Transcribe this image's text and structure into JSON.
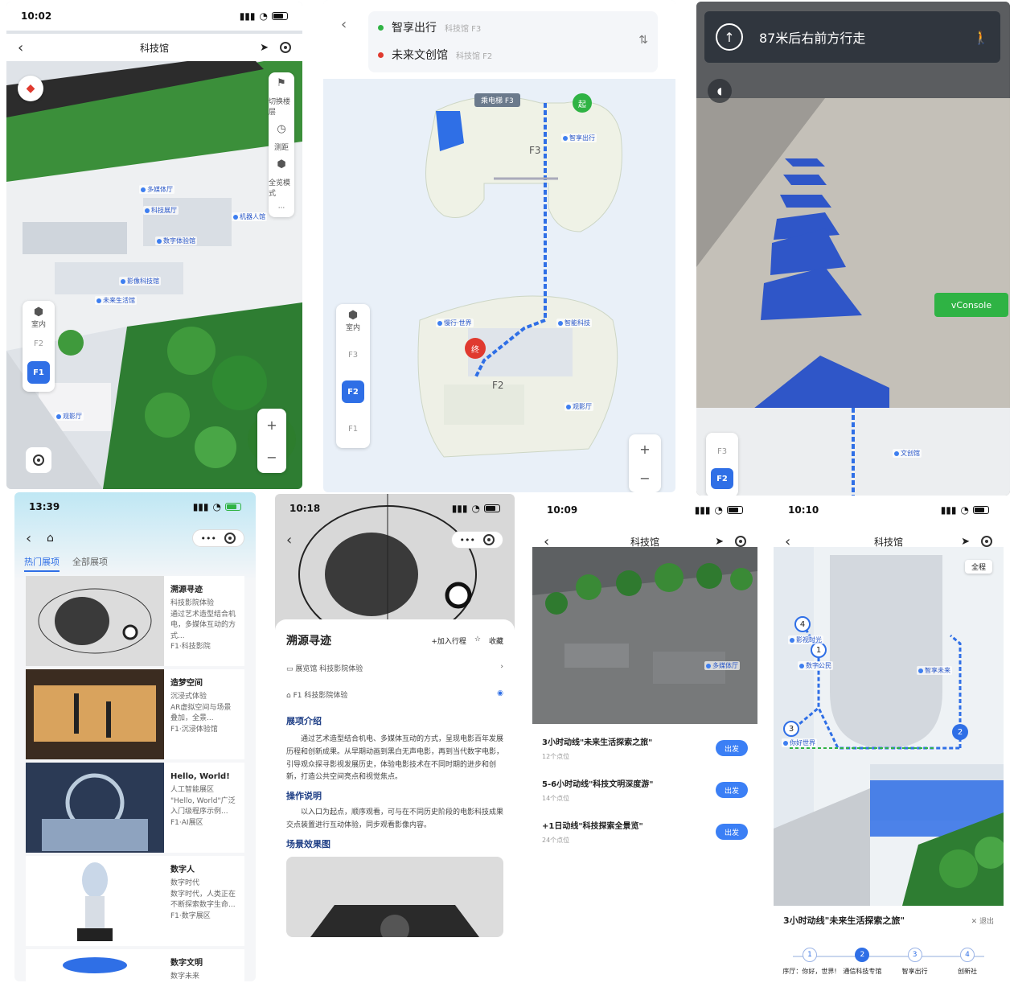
{
  "colors": {
    "accent": "#2f6fe6",
    "green": "#2fb344",
    "red": "#e03a2f",
    "tree": "#3f8f3a"
  },
  "p1": {
    "time": "10:02",
    "title": "科技馆",
    "side_tools": [
      "切换楼层",
      "测距",
      "全览模式"
    ],
    "floors": [
      "F2",
      "F1"
    ],
    "layers_label": "室内",
    "zoom_in": "+",
    "zoom_out": "−",
    "pois": [
      "多媒体厅",
      "科技展厅",
      "机器人馆",
      "数字体验馆",
      "影像科技馆",
      "未来生活馆",
      "观影厅"
    ]
  },
  "p2": {
    "from_label": "智享出行",
    "from_sub": "科技馆 F3",
    "to_label": "未来文创馆",
    "to_sub": "科技馆 F2",
    "elevator": "乘电梯 F3",
    "start": "起",
    "end": "终",
    "floors": [
      "室内",
      "F3",
      "F2",
      "F1"
    ],
    "floor_tags": [
      "F3",
      "F2"
    ],
    "pois": [
      "智享出行",
      "慢行·世界",
      "智能科技",
      "观影厅"
    ]
  },
  "p3": {
    "instruction": "87米后右前方行走",
    "vconsole": "vConsole",
    "floors": [
      "F3",
      "F2"
    ],
    "poi": "文创馆"
  },
  "p4": {
    "time": "13:39",
    "tabs": [
      "热门展项",
      "全部展项"
    ],
    "items": [
      {
        "title": "溯源寻迹",
        "sub": "科技影院体验",
        "desc": "通过艺术造型结合机电，多媒体互动的方式...",
        "meta": "F1·科技影院"
      },
      {
        "title": "造梦空间",
        "sub": "沉浸式体验",
        "desc": "AR虚拟空间与场景叠加，全景...",
        "meta": "F1·沉浸体验馆"
      },
      {
        "title": "Hello, World!",
        "sub": "人工智能展区",
        "desc": "\"Hello, World\"广泛入门级程序示例...",
        "meta": "F1·AI展区"
      },
      {
        "title": "数字人",
        "sub": "数字时代",
        "desc": "数字时代，人类正在不断探索数字生命...",
        "meta": "F1·数字展区"
      },
      {
        "title": "数字文明",
        "sub": "数字未来",
        "desc": "",
        "meta": ""
      }
    ]
  },
  "p5": {
    "time": "10:18",
    "title": "溯源寻迹",
    "add": "+加入行程",
    "fav": "收藏",
    "row1": "展览馆 科技影院体验",
    "row2": "F1 科技影院体验",
    "intro_h": "展项介绍",
    "intro": "通过艺术造型结合机电、多媒体互动的方式，呈现电影百年发展历程和创新成果。从早期动画到黑白无声电影，再到当代数字电影，引导观众探寻影视发展历史，体验电影技术在不同时期的进步和创新，打造公共空间亮点和视觉焦点。",
    "op_h": "操作说明",
    "op": "以入口为起点，顺序观看，可与在不同历史阶段的电影科技成果交点装置进行互动体验，同步观看影像内容。",
    "fx_h": "场景效果图"
  },
  "p6": {
    "time": "10:09",
    "title": "科技馆",
    "poi": "多媒体厅",
    "routes": [
      {
        "name": "3小时动线\"未来生活探索之旅\"",
        "points": "12个点位",
        "go": "出发"
      },
      {
        "name": "5-6小时动线\"科技文明深度游\"",
        "points": "14个点位",
        "go": "出发"
      },
      {
        "name": "+1日动线\"科技探索全景览\"",
        "points": "24个点位",
        "go": "出发"
      }
    ]
  },
  "p7": {
    "time": "10:10",
    "title": "科技馆",
    "route_title": "3小时动线\"未来生活探索之旅\"",
    "exit": "退出",
    "full": "全程",
    "markers": [
      "4",
      "1",
      "3",
      "2"
    ],
    "pois": [
      "影视时光",
      "数字公民",
      "智享未来",
      "你好世界"
    ],
    "steps": [
      "序厅：你好，世界!",
      "通信科技专馆",
      "智享出行",
      "创新社"
    ],
    "current_step": 2
  }
}
